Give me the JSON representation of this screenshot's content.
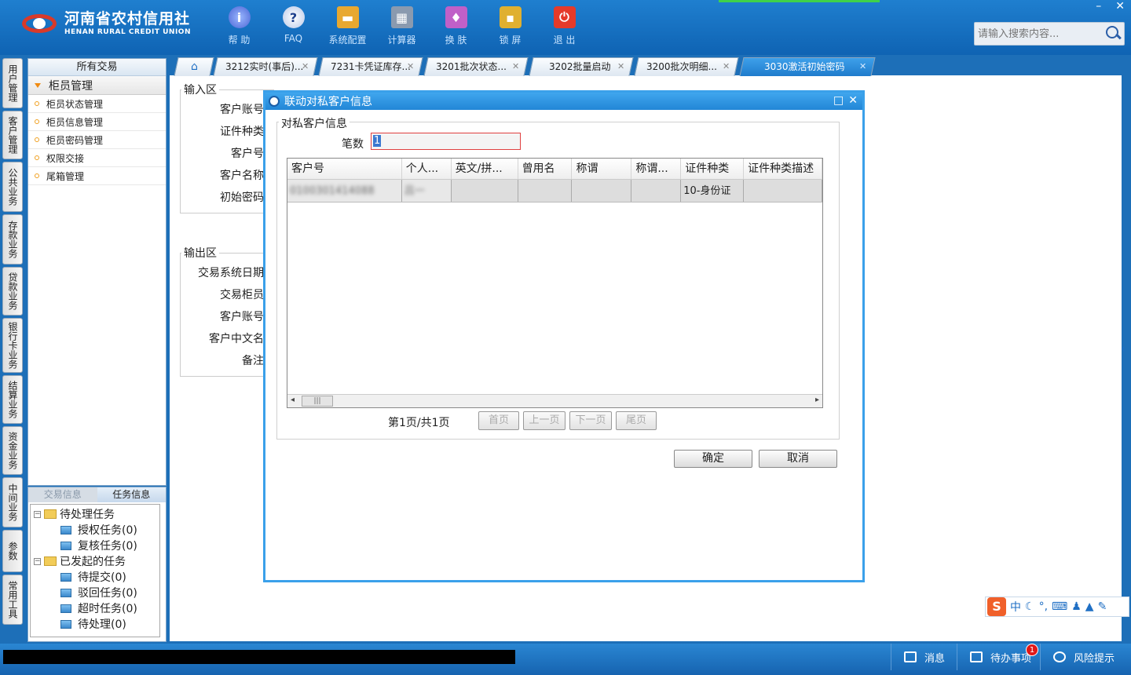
{
  "header": {
    "logo_cn": "河南省农村信用社",
    "logo_en": "HENAN RURAL CREDIT UNION",
    "tools": [
      {
        "label": "帮 助",
        "icon": "info-icon"
      },
      {
        "label": "FAQ",
        "icon": "faq-icon"
      },
      {
        "label": "系统配置",
        "icon": "toolbox-icon"
      },
      {
        "label": "计算器",
        "icon": "calculator-icon"
      },
      {
        "label": "换 肤",
        "icon": "tshirt-icon"
      },
      {
        "label": "锁 屏",
        "icon": "lock-icon"
      },
      {
        "label": "退 出",
        "icon": "power-icon"
      }
    ],
    "search_placeholder": "请输入搜索内容..."
  },
  "vnav": [
    "用户管理",
    "客户管理",
    "公共业务",
    "存款业务",
    "贷款业务",
    "银行卡业务",
    "结算业务",
    "资金业务",
    "中间业务",
    "参数",
    "常用工具"
  ],
  "left_panel": {
    "title": "所有交易",
    "group": "柜员管理",
    "items": [
      "柜员状态管理",
      "柜员信息管理",
      "柜员密码管理",
      "权限交接",
      "尾箱管理"
    ]
  },
  "task_panel": {
    "tabs": [
      "交易信息",
      "任务信息"
    ],
    "tree": {
      "pending": "待处理任务",
      "pending_children": [
        "授权任务(0)",
        "复核任务(0)"
      ],
      "started": "已发起的任务",
      "started_children": [
        "待提交(0)",
        "驳回任务(0)",
        "超时任务(0)",
        "待处理(0)"
      ]
    }
  },
  "tabs": [
    {
      "label": "3212实时(事后)..."
    },
    {
      "label": "7231卡凭证库存..."
    },
    {
      "label": "3201批次状态..."
    },
    {
      "label": "3202批量启动"
    },
    {
      "label": "3200批次明细..."
    },
    {
      "label": "3030激活初始密码"
    }
  ],
  "form": {
    "input_area": "输入区",
    "input_labels": [
      "客户账号",
      "证件种类",
      "客户号",
      "客户名称",
      "初始密码"
    ],
    "output_area": "输出区",
    "output_labels": [
      "交易系统日期",
      "交易柜员",
      "客户账号",
      "客户中文名",
      "备注"
    ]
  },
  "modal": {
    "title": "联动对私客户信息",
    "section": "对私客户信息",
    "count_label": "笔数",
    "count_value": "1",
    "columns": [
      "客户号",
      "个人...",
      "英文/拼...",
      "曾用名",
      "称谓",
      "称谓...",
      "证件种类",
      "证件种类描述"
    ],
    "row": [
      "0100301414088",
      "吕一",
      "",
      "",
      "",
      "",
      "10-身份证",
      ""
    ],
    "page_info": "第1页/共1页",
    "pager": [
      "首页",
      "上一页",
      "下一页",
      "尾页"
    ],
    "ok": "确定",
    "cancel": "取消"
  },
  "ime": {
    "mode": "中"
  },
  "status": {
    "message": "消息",
    "todo": "待办事项",
    "todo_count": "1",
    "risk": "风险提示"
  }
}
